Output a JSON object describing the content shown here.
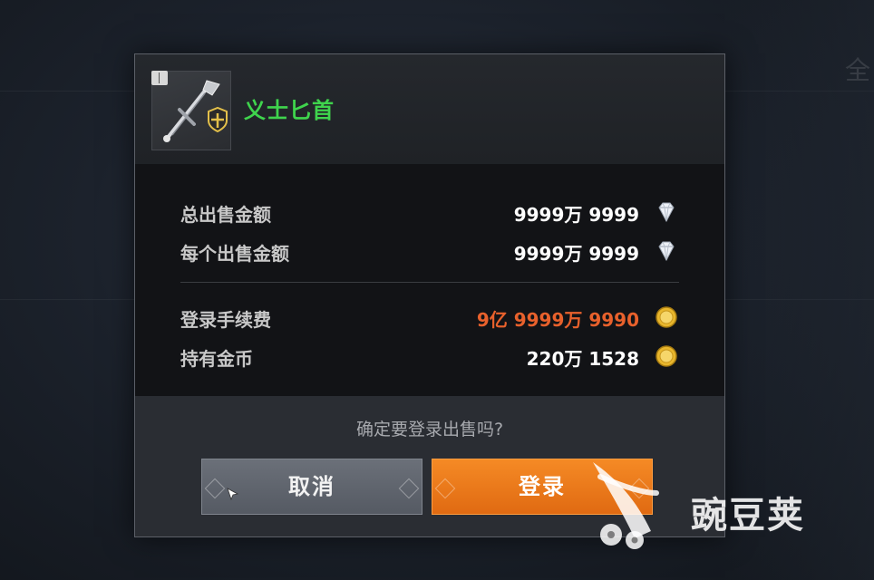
{
  "item": {
    "name": "义士匕首",
    "icon": "dagger-icon",
    "name_color": "#3fd44d"
  },
  "rows": [
    {
      "label": "总出售金额",
      "value": "9999万 9999",
      "currency": "diamond-icon"
    },
    {
      "label": "每个出售金额",
      "value": "9999万 9999",
      "currency": "diamond-icon"
    },
    {
      "label": "登录手续费",
      "value": "9亿 9999万 9990",
      "currency": "gold-coin-icon",
      "value_color": "#e8612c"
    },
    {
      "label": "持有金币",
      "value": "220万 1528",
      "currency": "gold-coin-icon"
    }
  ],
  "confirm_text": "确定要登录出售吗?",
  "buttons": {
    "cancel_label": "取消",
    "register_label": "登录"
  },
  "watermark": {
    "text": "豌豆荚"
  },
  "colors": {
    "accent_orange": "#f07a1c",
    "fee_red": "#e8612c",
    "item_green": "#3fd44d"
  }
}
